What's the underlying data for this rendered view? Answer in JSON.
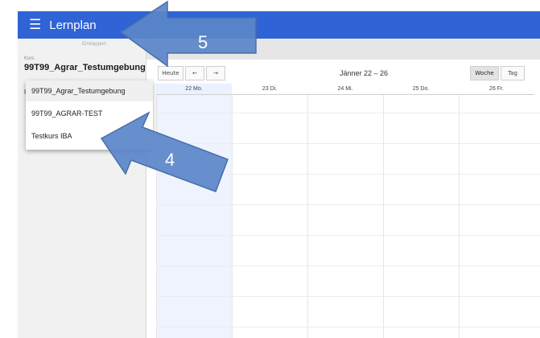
{
  "appbar": {
    "menu_icon": "menu-icon",
    "title": "Lernplan"
  },
  "sidebar": {
    "collapse_label": "Einklappen",
    "kurs_label": "Kurs",
    "kurs_value": "99T99_Agrar_Testumgebung",
    "hidden_letter": "K"
  },
  "toolbar": {
    "today_label": "Heute",
    "prev_label": "←",
    "next_label": "→",
    "range_title": "Jänner 22 – 26",
    "week_label": "Woche",
    "day_label": "Tag"
  },
  "calendar": {
    "days": [
      {
        "label": "22 Mo.",
        "today": true
      },
      {
        "label": "23 Di.",
        "today": false
      },
      {
        "label": "24 Mi.",
        "today": false
      },
      {
        "label": "25 Do.",
        "today": false
      },
      {
        "label": "26 Fr.",
        "today": false
      }
    ]
  },
  "dropdown": {
    "options": [
      "99T99_Agrar_Testumgebung",
      "99T99_AGRAR-TEST",
      "Testkurs IBA"
    ],
    "selected": "99T99_Agrar_Testumgebung"
  },
  "annotations": {
    "arrow_top_number": "5",
    "arrow_bottom_number": "4",
    "arrow_color": "#5b86c9"
  }
}
